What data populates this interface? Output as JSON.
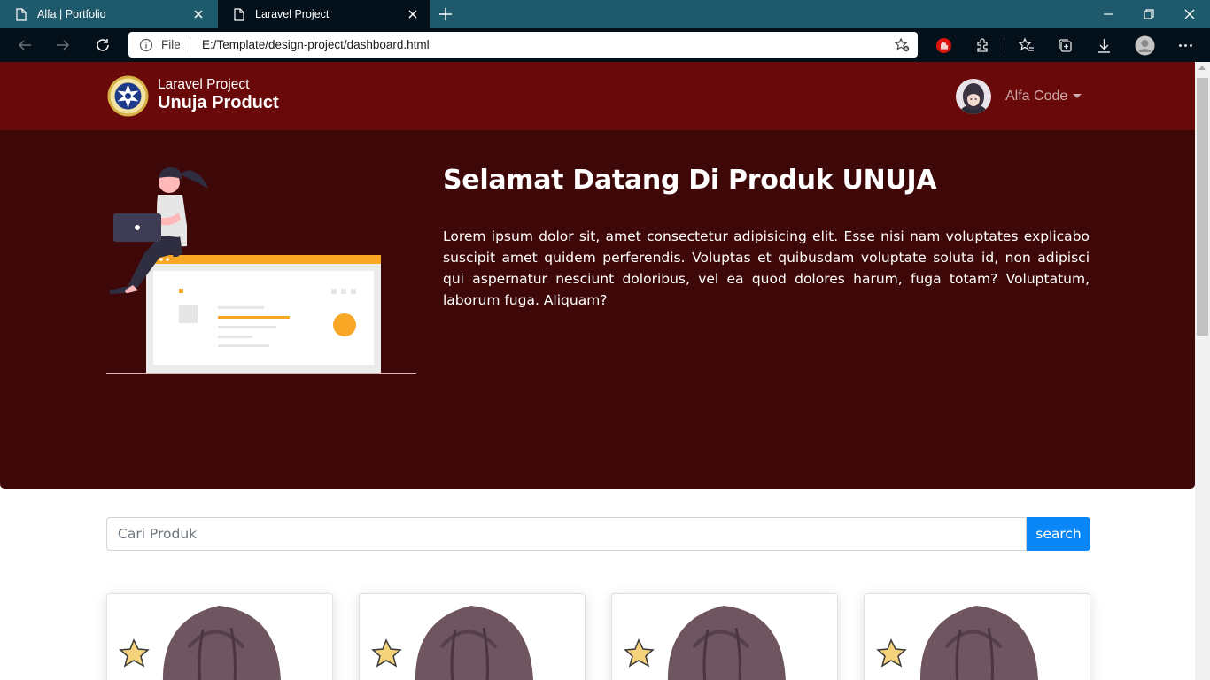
{
  "browser": {
    "tabs": [
      {
        "title": "Alfa | Portfolio",
        "active": false
      },
      {
        "title": "Laravel Project",
        "active": true
      }
    ],
    "address": {
      "protocol": "File",
      "url": "E:/Template/design-project/dashboard.html"
    },
    "colors": {
      "tab_strip": "#1f5a6c",
      "toolbar": "#04111a"
    }
  },
  "navbar": {
    "brand_subtitle": "Laravel Project",
    "brand_title": "Unuja Product",
    "user_name": "Alfa Code",
    "background": "#6a090a"
  },
  "hero": {
    "title": "Selamat Datang Di Produk UNUJA",
    "paragraph": "Lorem ipsum dolor sit, amet consectetur adipisicing elit. Esse nisi nam voluptates explicabo suscipit amet quidem perferendis. Voluptas et quibusdam voluptate soluta id, non adipisci qui aspernatur nesciunt doloribus, vel ea quod dolores harum, fuga totam? Voluptatum, laborum fuga. Aliquam?",
    "background": "#3f0808"
  },
  "search": {
    "placeholder": "Cari Produk",
    "button_label": "search",
    "button_color": "#0a86f6"
  },
  "products": {
    "card_count": 4
  }
}
